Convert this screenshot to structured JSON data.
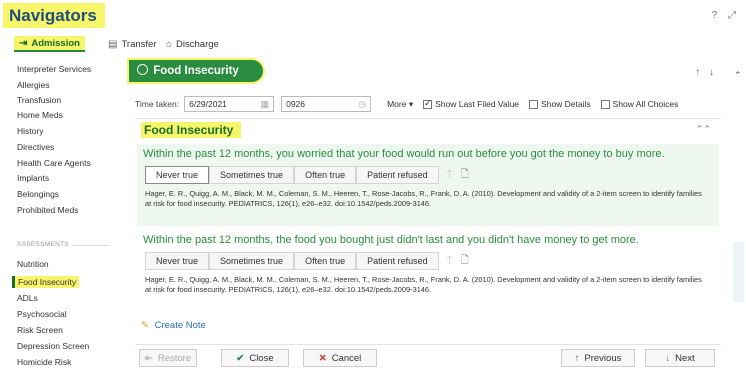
{
  "header": {
    "title": "Navigators",
    "help_icon": "?",
    "expand_icon": "⤢"
  },
  "tabs": [
    {
      "label": "Admission",
      "icon": "admission-icon"
    },
    {
      "label": "Transfer",
      "icon": "transfer-icon"
    },
    {
      "label": "Discharge",
      "icon": "discharge-icon"
    }
  ],
  "sidebar": {
    "items": [
      "Interpreter Services",
      "Allergies",
      "Transfusion",
      "Home Meds",
      "History",
      "Directives",
      "Health Care Agents",
      "Implants",
      "Belongings",
      "Prohibited Meds"
    ],
    "section_label": "ASSESSMENTS",
    "assessment_items": [
      "Nutrition",
      "Food Insecurity",
      "ADLs",
      "Psychosocial",
      "Risk Screen",
      "Depression Screen",
      "Homicide Risk"
    ],
    "selected": "Food Insecurity"
  },
  "window": {
    "title": "Food Insecurity"
  },
  "time_row": {
    "label": "Time taken:",
    "date": "6/29/2021",
    "time": "0926",
    "more": "More ▾",
    "show_last_filed": "Show Last Filed Value",
    "show_details": "Show Details",
    "show_all_choices": "Show All Choices",
    "show_last_filed_checked": true
  },
  "section": {
    "title": "Food Insecurity"
  },
  "questions": [
    {
      "text": "Within the past 12 months, you worried that your food would run out before you got the money to buy more.",
      "options": [
        "Never true",
        "Sometimes true",
        "Often true",
        "Patient refused"
      ],
      "citation": "Hager, E. R., Quigg, A. M., Black, M. M., Coleman, S. M., Heeren, T., Rose-Jacobs, R., Frank, D. A. (2010). Development and validity of a 2-item screen to identify families at risk for food insecurity. PEDIATRICS, 126(1), e26–e32. doi:10.1542/peds.2009-3146."
    },
    {
      "text": "Within the past 12 months, the food you bought just didn't last and you didn't have money to get more.",
      "options": [
        "Never true",
        "Sometimes true",
        "Often true",
        "Patient refused"
      ],
      "citation": "Hager, E. R., Quigg, A. M., Black, M. M., Coleman, S. M., Heeren, T., Rose-Jacobs, R., Frank, D. A. (2010). Development and validity of a 2-item screen to identify families at risk for food insecurity. PEDIATRICS, 126(1), e26–e32. doi:10.1542/peds.2009-3146."
    }
  ],
  "create_note": "Create Note",
  "footer": {
    "restore": "Restore",
    "close": "Close",
    "cancel": "Cancel",
    "previous": "Previous",
    "next": "Next"
  },
  "colors": {
    "accent_green": "#2a8c3e",
    "highlight_yellow": "#f7f56a",
    "title_blue": "#1f4f7a",
    "link_blue": "#2a6fb0"
  }
}
